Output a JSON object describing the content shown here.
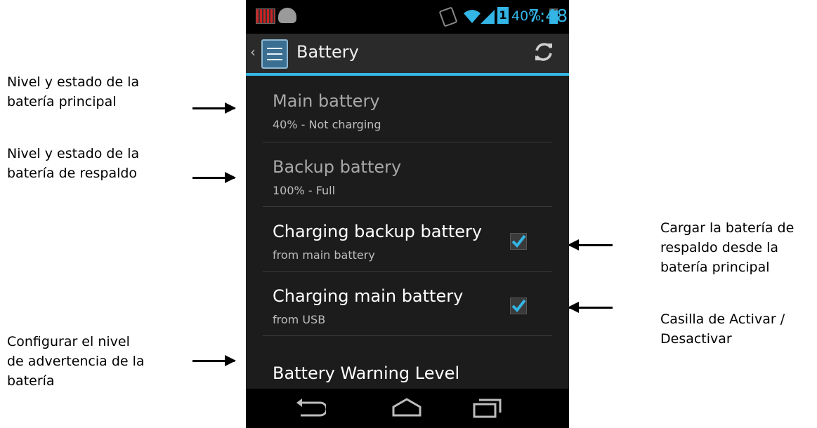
{
  "annotations": {
    "main_status": [
      "Nivel y estado de la",
      "batería principal"
    ],
    "backup_status": [
      "Nivel y estado de la",
      "batería de respaldo"
    ],
    "warning": [
      "Configurar el nivel",
      "de advertencia de la",
      "batería"
    ],
    "charge_backup": [
      "Cargar la batería de",
      "respaldo desde la",
      "batería principal"
    ],
    "toggle": [
      "Casilla de Activar /",
      "Desactivar"
    ]
  },
  "status_bar": {
    "sim_slot": "1",
    "battery_percent": "40%",
    "time": "7:48"
  },
  "action_bar": {
    "title": "Battery"
  },
  "settings": [
    {
      "title": "Main battery",
      "summary": "40% - Not charging"
    },
    {
      "title": "Backup battery",
      "summary": "100% - Full"
    },
    {
      "title": "Charging backup battery",
      "summary": "from main battery",
      "checked": true
    },
    {
      "title": "Charging main battery",
      "summary": "from USB",
      "checked": true
    },
    {
      "title": "Battery Warning Level",
      "summary": ""
    }
  ],
  "colors": {
    "accent": "#33b5e5",
    "background": "#1c1c1c",
    "text": "#ffffff"
  },
  "icons": [
    "notification-bars-icon",
    "android-icon",
    "vibrate-icon",
    "wifi-icon",
    "signal-icon",
    "battery-icon",
    "back-chevron-icon",
    "settings-app-icon",
    "refresh-icon",
    "checkbox-checked-icon",
    "nav-back-icon",
    "nav-home-icon",
    "nav-recents-icon"
  ]
}
